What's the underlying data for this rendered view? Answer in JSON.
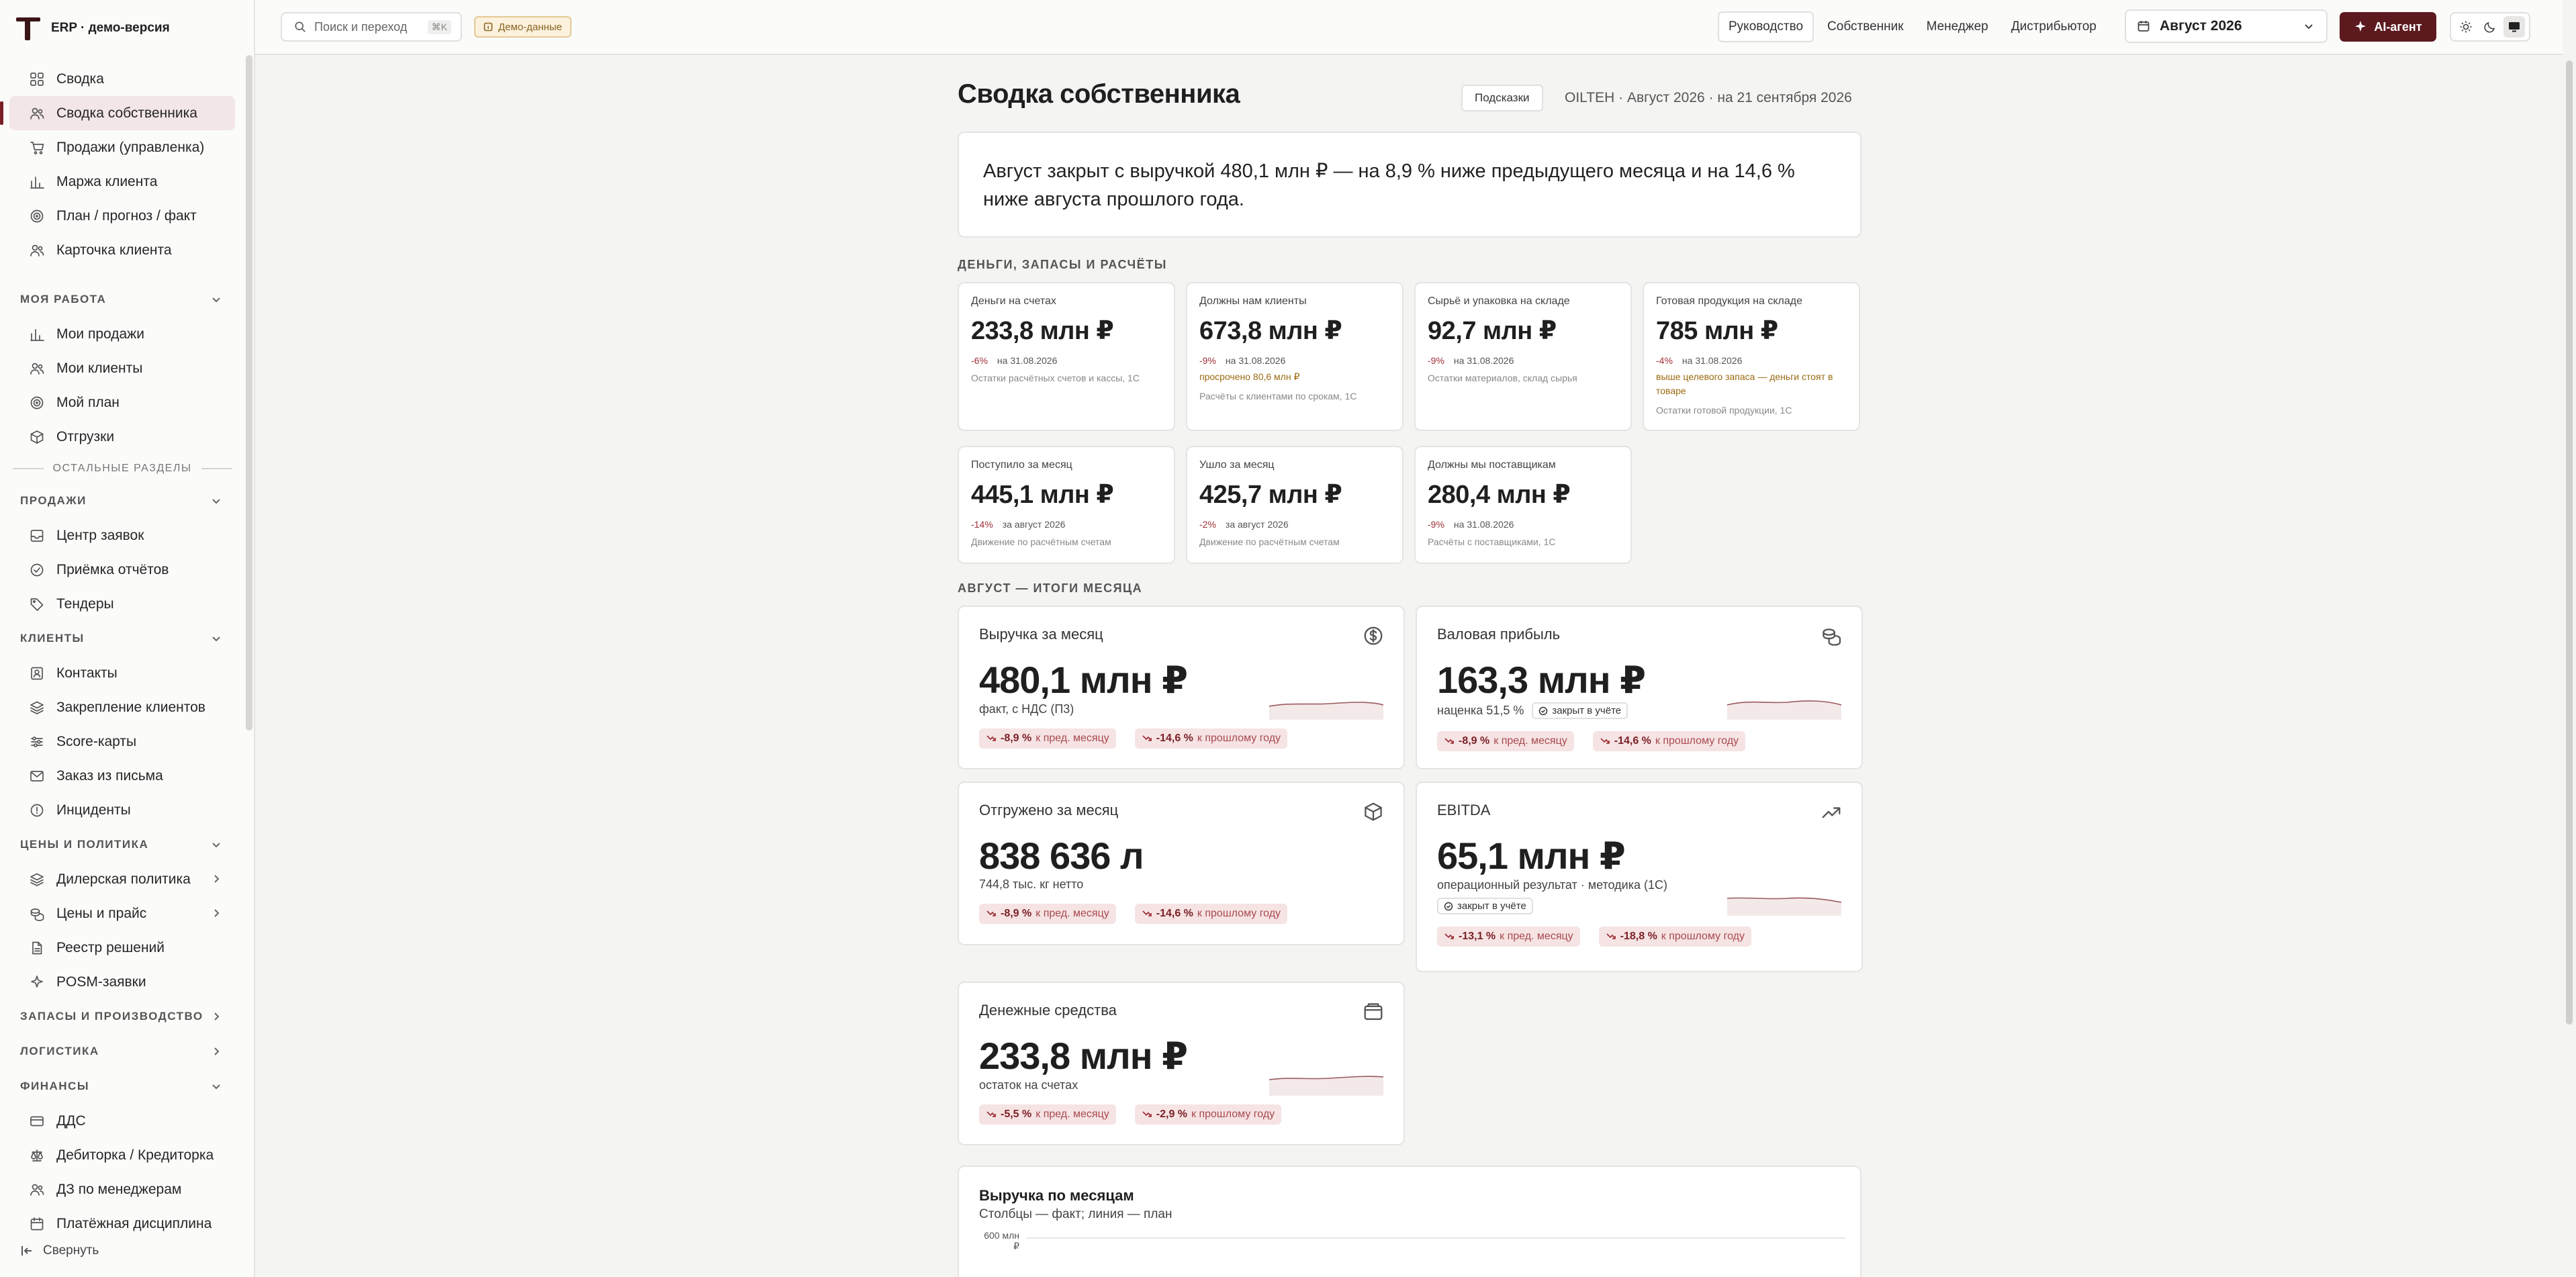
{
  "app": {
    "title": "ERP · демо-версия"
  },
  "search": {
    "placeholder": "Поиск и переход",
    "shortcut": "⌘K"
  },
  "demo_badge": "Демо-данные",
  "roles": [
    "Руководство",
    "Собственник",
    "Менеджер",
    "Дистрибьютор"
  ],
  "period": "Август 2026",
  "ai_button": "AI-агент",
  "sidebar": {
    "top": [
      {
        "label": "Сводка",
        "icon": "grid-icon"
      },
      {
        "label": "Сводка собственника",
        "icon": "users-icon",
        "active": true
      },
      {
        "label": "Продажи (управленка)",
        "icon": "cart-icon"
      },
      {
        "label": "Маржа клиента",
        "icon": "chart-icon"
      },
      {
        "label": "План / прогноз / факт",
        "icon": "target-icon"
      },
      {
        "label": "Карточка клиента",
        "icon": "users-icon"
      }
    ],
    "my_work_title": "МОЯ РАБОТА",
    "my_work": [
      {
        "label": "Мои продажи",
        "icon": "chart-icon"
      },
      {
        "label": "Мои клиенты",
        "icon": "users-icon"
      },
      {
        "label": "Мой план",
        "icon": "target-icon"
      },
      {
        "label": "Отгрузки",
        "icon": "box-icon"
      }
    ],
    "other_sections": "ОСТАЛЬНЫЕ РАЗДЕЛЫ",
    "sales_title": "ПРОДАЖИ",
    "sales": [
      {
        "label": "Центр заявок",
        "icon": "inbox-icon"
      },
      {
        "label": "Приёмка отчётов",
        "icon": "check-icon"
      },
      {
        "label": "Тендеры",
        "icon": "tag-icon"
      }
    ],
    "clients_title": "КЛИЕНТЫ",
    "clients": [
      {
        "label": "Контакты",
        "icon": "contacts-icon"
      },
      {
        "label": "Закрепление клиентов",
        "icon": "layers-icon"
      },
      {
        "label": "Score-карты",
        "icon": "sliders-icon"
      },
      {
        "label": "Заказ из письма",
        "icon": "mail-icon"
      },
      {
        "label": "Инциденты",
        "icon": "alert-icon"
      }
    ],
    "pricing_title": "ЦЕНЫ И ПОЛИТИКА",
    "pricing": [
      {
        "label": "Дилерская политика",
        "icon": "layers-icon",
        "chevron": true
      },
      {
        "label": "Цены и прайс",
        "icon": "coins-icon",
        "chevron": true
      },
      {
        "label": "Реестр решений",
        "icon": "doc-icon"
      },
      {
        "label": "POSM-заявки",
        "icon": "sparkle-icon"
      }
    ],
    "stock_title": "ЗАПАСЫ И ПРОИЗВОДСТВО",
    "logistics_title": "ЛОГИСТИКА",
    "finance_title": "ФИНАНСЫ",
    "finance": [
      {
        "label": "ДДС",
        "icon": "card-icon"
      },
      {
        "label": "Дебиторка / Кредиторка",
        "icon": "scale-icon"
      },
      {
        "label": "ДЗ по менеджерам",
        "icon": "users-icon"
      },
      {
        "label": "Платёжная дисциплина",
        "icon": "calendar-icon"
      }
    ],
    "collapse": "Свернуть"
  },
  "page": {
    "title": "Сводка собственника",
    "hints": "Подсказки",
    "meta": "OILTEH · Август 2026 · на 21 сентября 2026",
    "summary": "Август закрыт с выручкой 480,1 млн ₽ — на 8,9 % ниже предыдущего месяца и на 14,6 % ниже августа прошлого года."
  },
  "money_section": "ДЕНЬГИ, ЗАПАСЫ И РАСЧЁТЫ",
  "kpis": [
    {
      "label": "Деньги на счетах",
      "value": "233,8 млн ₽",
      "delta": "-6%",
      "date": "на 31.08.2026",
      "warn": "",
      "src": "Остатки расчётных счетов и кассы, 1С"
    },
    {
      "label": "Должны нам клиенты",
      "value": "673,8 млн ₽",
      "delta": "-9%",
      "date": "на 31.08.2026",
      "warn": "просрочено 80,6 млн ₽",
      "src": "Расчёты с клиентами по срокам, 1С"
    },
    {
      "label": "Сырьё и упаковка на складе",
      "value": "92,7 млн ₽",
      "delta": "-9%",
      "date": "на 31.08.2026",
      "warn": "",
      "src": "Остатки материалов, склад сырья"
    },
    {
      "label": "Готовая продукция на складе",
      "value": "785 млн ₽",
      "delta": "-4%",
      "date": "на 31.08.2026",
      "warn": "выше целевого запаса — деньги стоят в товаре",
      "src": "Остатки готовой продукции, 1С"
    },
    {
      "label": "Поступило за месяц",
      "value": "445,1 млн ₽",
      "delta": "-14%",
      "date": "за август 2026",
      "warn": "",
      "src": "Движение по расчётным счетам"
    },
    {
      "label": "Ушло за месяц",
      "value": "425,7 млн ₽",
      "delta": "-2%",
      "date": "за август 2026",
      "warn": "",
      "src": "Движение по расчётным счетам"
    },
    {
      "label": "Должны мы поставщикам",
      "value": "280,4 млн ₽",
      "delta": "-9%",
      "date": "на 31.08.2026",
      "warn": "",
      "src": "Расчёты с поставщиками, 1С"
    }
  ],
  "month_section": "АВГУСТ — ИТОГИ МЕСЯЦА",
  "big_cards": [
    {
      "label": "Выручка за месяц",
      "icon": "dollar-icon",
      "value": "480,1 млн ₽",
      "sub": "факт, с НДС (П3)",
      "closed": "",
      "p1": "-8,9 %",
      "p1t": "к пред. месяцу",
      "p2": "-14,6 %",
      "p2t": "к прошлому году"
    },
    {
      "label": "Валовая прибыль",
      "icon": "coins-icon",
      "value": "163,3 млн ₽",
      "sub": "наценка 51,5 %",
      "closed": "закрыт в учёте",
      "p1": "-8,9 %",
      "p1t": "к пред. месяцу",
      "p2": "-14,6 %",
      "p2t": "к прошлому году"
    },
    {
      "label": "Отгружено за месяц",
      "icon": "box-icon",
      "value": "838 636 л",
      "sub": "744,8 тыс. кг нетто",
      "closed": "",
      "p1": "-8,9 %",
      "p1t": "к пред. месяцу",
      "p2": "-14,6 %",
      "p2t": "к прошлому году"
    },
    {
      "label": "EBITDA",
      "icon": "trend-icon",
      "value": "65,1 млн ₽",
      "sub": "операционный результат · методика (1С)",
      "closed": "закрыт в учёте",
      "p1": "-13,1 %",
      "p1t": "к пред. месяцу",
      "p2": "-18,8 %",
      "p2t": "к прошлому году"
    },
    {
      "label": "Денежные средства",
      "icon": "wallet-icon",
      "value": "233,8 млн ₽",
      "sub": "остаток на счетах",
      "closed": "",
      "p1": "-5,5 %",
      "p1t": "к пред. месяцу",
      "p2": "-2,9 %",
      "p2t": "к прошлому году"
    }
  ],
  "revenue_chart": {
    "title": "Выручка по месяцам",
    "subtitle": "Столбцы — факт; линия — план",
    "tick": "600 млн ₽"
  },
  "colors": {
    "accent": "#5c1a1f",
    "negative": "#a03037",
    "pill_bg": "#f6e3e3"
  }
}
